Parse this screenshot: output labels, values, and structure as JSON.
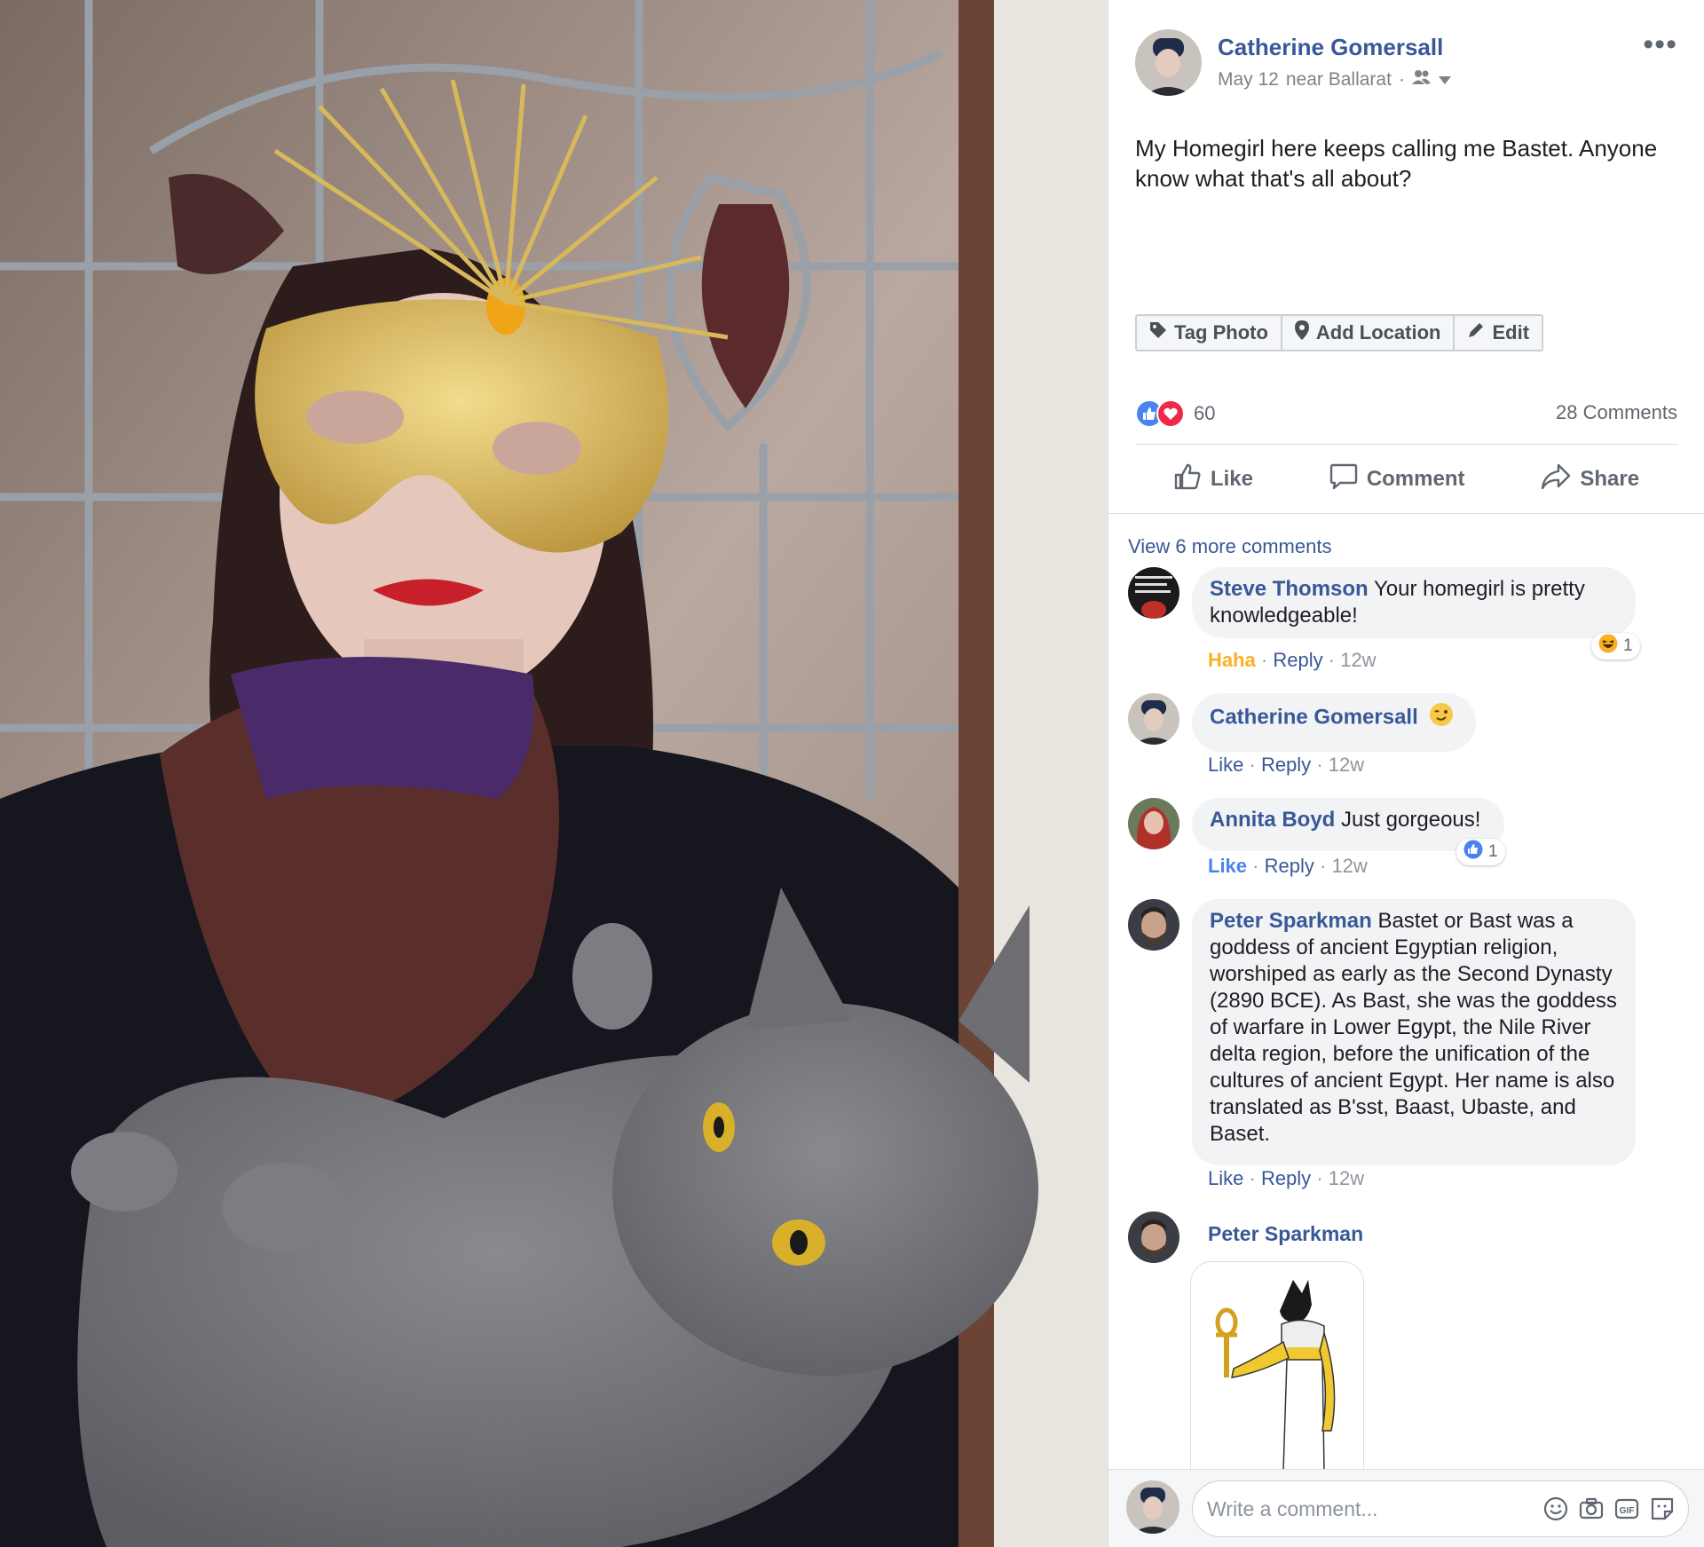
{
  "post": {
    "author": "Catherine Gomersall",
    "date": "May 12",
    "location_text": "near Ballarat",
    "separator": "·",
    "text": "My Homegirl here keeps calling me Bastet. Anyone know what that's all about?",
    "more_icon": "•••"
  },
  "photo_actions": {
    "tag_photo": "Tag Photo",
    "add_location": "Add Location",
    "edit": "Edit"
  },
  "reactions": {
    "count": "60",
    "comments_count": "28 Comments"
  },
  "actions": {
    "like": "Like",
    "comment": "Comment",
    "share": "Share"
  },
  "comments": {
    "view_more": "View 6 more comments",
    "items": [
      {
        "name": "Steve Thomson",
        "text": "Your homegirl is pretty knowledgeable!",
        "reaction_label": "Haha",
        "reply": "Reply",
        "time": "12w",
        "badge_count": "1"
      },
      {
        "name": "Catherine Gomersall",
        "text": "",
        "reaction_label": "Like",
        "reply": "Reply",
        "time": "12w"
      },
      {
        "name": "Annita Boyd",
        "text": "Just gorgeous!",
        "reaction_label": "Like",
        "reply": "Reply",
        "time": "12w",
        "badge_count": "1"
      },
      {
        "name": "Peter Sparkman",
        "text": "Bastet or Bast was a goddess of ancient Egyptian religion, worshiped as early as the Second Dynasty (2890 BCE). As Bast, she was the goddess of warfare in Lower Egypt, the Nile River delta region, before the unification of the cultures of ancient Egypt. Her name is also translated as B'sst, Baast, Ubaste, and Baset.",
        "reaction_label": "Like",
        "reply": "Reply",
        "time": "12w"
      },
      {
        "name": "Peter Sparkman"
      }
    ]
  },
  "composer": {
    "placeholder": "Write a comment...",
    "icons": [
      "emoji-icon",
      "camera-icon",
      "gif-icon",
      "sticker-icon"
    ]
  },
  "colors": {
    "link_blue": "#385898",
    "like_blue": "#4a83f0",
    "love_red": "#f0284a",
    "haha_yellow": "#f7b125",
    "bubble_grey": "#f2f3f5"
  }
}
